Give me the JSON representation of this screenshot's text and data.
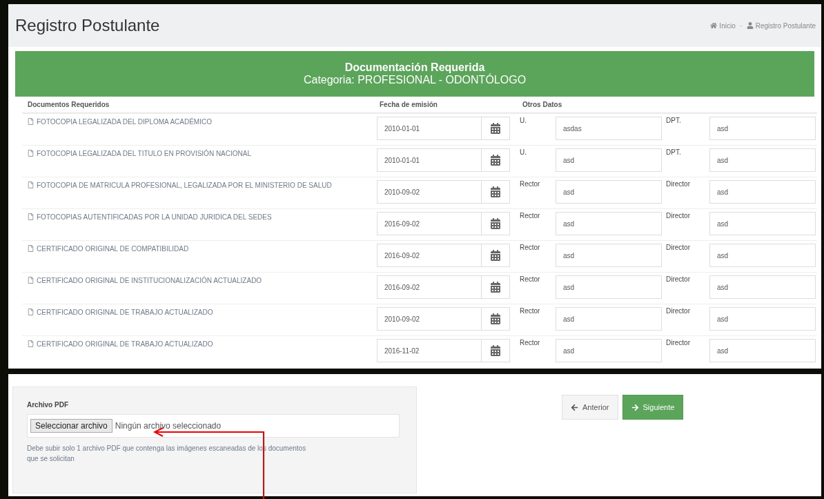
{
  "header": {
    "title": "Registro Postulante",
    "breadcrumb": [
      {
        "label": "Inicio",
        "kind": "home"
      },
      {
        "label": "Registro Postulante",
        "kind": "user"
      }
    ]
  },
  "banner": {
    "title": "Documentación Requerida",
    "subtitle": "Categoria: PROFESIONAL - ODONTÓLOGO"
  },
  "table": {
    "columns": [
      "Documentos Requeridos",
      "Fecha de emisión",
      "Otros Datos"
    ],
    "rows": [
      {
        "document": "FOTOCOPIA LEGALIZADA DEL DIPLOMA ACADÉMICO",
        "date": "2010-01-01",
        "label_1": "U.",
        "value_1": "asdas",
        "label_2": "DPT.",
        "value_2": "asd"
      },
      {
        "document": "FOTOCOPIA LEGALIZADA DEL TITULO EN PROVISIÓN NACIONAL",
        "date": "2010-01-01",
        "label_1": "U.",
        "value_1": "asd",
        "label_2": "DPT.",
        "value_2": "asd"
      },
      {
        "document": "FOTOCOPIA DE MATRICULA PROFESIONAL, LEGALIZADA POR EL MINISTERIO DE SALUD",
        "date": "2010-09-02",
        "label_1": "Rector",
        "value_1": "asd",
        "label_2": "Director",
        "value_2": "asd"
      },
      {
        "document": "FOTOCOPIAS AUTENTIFICADAS POR LA UNIDAD JURIDICA DEL SEDES",
        "date": "2016-09-02",
        "label_1": "Rector",
        "value_1": "asd",
        "label_2": "Director",
        "value_2": "asd"
      },
      {
        "document": "CERTIFICADO ORIGINAL DE COMPATIBILIDAD",
        "date": "2016-09-02",
        "label_1": "Rector",
        "value_1": "asd",
        "label_2": "Director",
        "value_2": "asd"
      },
      {
        "document": "CERTIFICADO ORIGINAL DE INSTITUCIONALIZACIÓN ACTUALIZADO",
        "date": "2016-09-02",
        "label_1": "Rector",
        "value_1": "asd",
        "label_2": "Director",
        "value_2": "asd"
      },
      {
        "document": "CERTIFICADO ORIGINAL DE TRABAJO ACTUALIZADO",
        "date": "2010-09-02",
        "label_1": "Rector",
        "value_1": "asd",
        "label_2": "Director",
        "value_2": "asd"
      },
      {
        "document": "CERTIFICADO ORIGINAL DE TRABAJO ACTUALIZADO",
        "date": "2016-11-02",
        "label_1": "Rector",
        "value_1": "asd",
        "label_2": "Director",
        "value_2": "asd"
      }
    ]
  },
  "upload": {
    "label": "Archivo PDF",
    "button": "Seleccionar archivo",
    "status": "Ningún archivo seleccionado",
    "help": "Debe subir solo 1 archivo PDF que contenga las imágenes escaneadas de los documentos que se solicitan"
  },
  "buttons": [
    {
      "label": "Anterior",
      "kind": "back"
    },
    {
      "label": "Siguiente",
      "kind": "next"
    }
  ]
}
